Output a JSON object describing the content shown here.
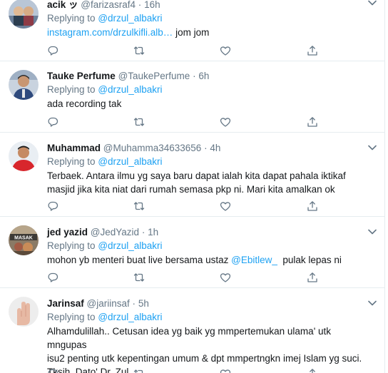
{
  "tweets": [
    {
      "name": "acik ッ",
      "handle": "@farizasraf4",
      "separator": "·",
      "time": "16h",
      "replying_prefix": "Replying to",
      "replying_to": "@drzul_albakri",
      "link": "instagram.com/drzulkifli.alb…",
      "text_after_link": " jom jom"
    },
    {
      "name": "Tauke Perfume",
      "handle": "@TaukePerfume",
      "separator": "·",
      "time": "6h",
      "replying_prefix": "Replying to",
      "replying_to": "@drzul_albakri",
      "text": "ada recording tak"
    },
    {
      "name": "Muhammad",
      "handle": "@Muhamma34633656",
      "separator": "·",
      "time": "4h",
      "replying_prefix": "Replying to",
      "replying_to": "@drzul_albakri",
      "text_line1": "Terbaek. Antara ilmu yg saya baru dapat ialah kita dapat pahala iktikaf",
      "text_line2": "masjid jika kita niat dari rumah semasa pkp ni. Mari kita amalkan ok"
    },
    {
      "name": "jed yazid",
      "handle": "@JedYazid",
      "separator": "·",
      "time": "1h",
      "replying_prefix": "Replying to",
      "replying_to": "@drzul_albakri",
      "text_before_mention": "mohon yb menteri buat live bersama ustaz ",
      "mention": "@Ebitlew_",
      "text_after_mention": "  pulak lepas ni",
      "avatar_overlay": "MASAK"
    },
    {
      "name": "Jarinsaf",
      "handle": "@jariinsaf",
      "separator": "·",
      "time": "5h",
      "replying_prefix": "Replying to",
      "replying_to": "@drzul_albakri",
      "text_line1": "Alhamdulillah.. Cetusan idea yg baik yg mmpertemukan ulama' utk mngupas",
      "text_line2": "isu2 penting utk kepentingan umum & dpt mmpertngkn imej Islam yg suci.",
      "text_line3": "Tksih, Dato' Dr. Zul."
    }
  ],
  "colors": {
    "link_blue": "#1da1f2",
    "meta_gray": "#657786",
    "text_dark": "#14171a",
    "divider": "#e6ecf0"
  },
  "icons": [
    "reply-icon",
    "retweet-icon",
    "like-icon",
    "share-icon",
    "caret-down-icon"
  ]
}
